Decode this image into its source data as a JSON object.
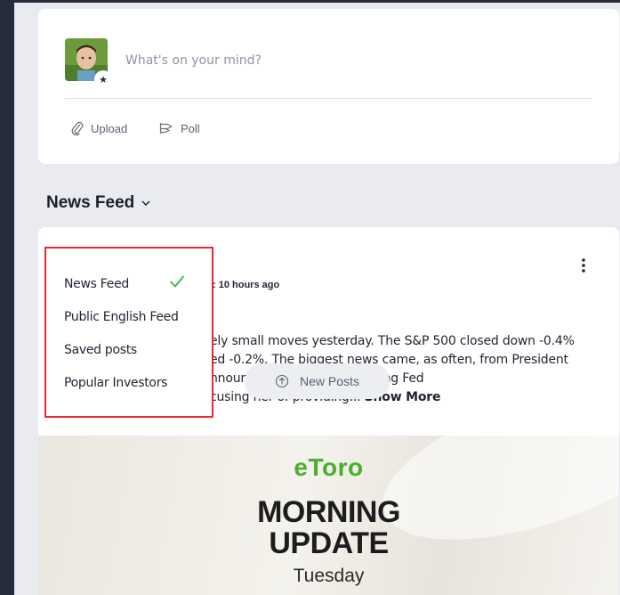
{
  "composer": {
    "placeholder": "What's on your mind?",
    "upload_label": "Upload",
    "poll_label": "Poll",
    "avatar_badge_icon": "star-icon"
  },
  "feed": {
    "title": "News Feed",
    "menu_items": [
      {
        "label": "News Feed",
        "selected": true
      },
      {
        "label": "Public English Feed",
        "selected": false
      },
      {
        "label": "Saved posts",
        "selected": false
      },
      {
        "label": "Popular Investors",
        "selected": false
      }
    ]
  },
  "post": {
    "time": ": 10 hours ago",
    "text_lines": [
      "ely small moves yesterday. The S&P 500 closed down -0.4%",
      "ed -0.2%. The biggest news came, as often, from President",
      "nnounced that he is dismissing Fed",
      "cusing her of providing..."
    ],
    "show_more": "Show More",
    "new_posts_label": "New Posts",
    "image": {
      "brand": "eToro",
      "headline_line1": "MORNING",
      "headline_line2": "UPDATE",
      "day": "Tuesday"
    }
  },
  "colors": {
    "accent_green": "#4cae31",
    "highlight_red": "#e8292f",
    "check_green": "#3bb54a",
    "sidebar_dark": "#272c3d"
  }
}
